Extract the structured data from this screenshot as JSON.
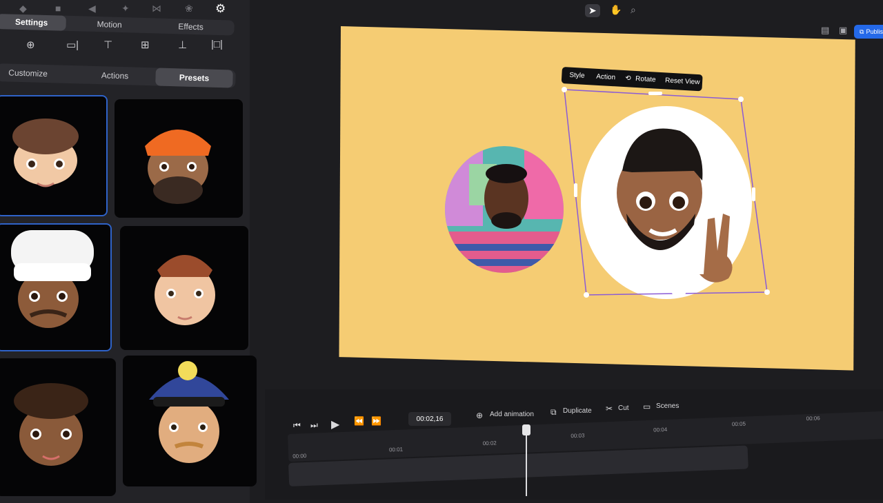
{
  "left_panel": {
    "top_icons": [
      "shape-icon",
      "square-icon",
      "audio-icon",
      "magic-icon",
      "bow-icon",
      "palette-icon",
      "gear-icon"
    ],
    "tabs": [
      {
        "label": "Settings",
        "selected": true
      },
      {
        "label": "Motion",
        "selected": false
      },
      {
        "label": "Effects",
        "selected": false
      }
    ],
    "align_icons": [
      "align-center-horizontal-icon",
      "align-right-icon",
      "align-top-icon",
      "align-middle-icon",
      "align-bottom-icon",
      "distribute-icon"
    ],
    "subtabs": [
      {
        "label": "Customize",
        "selected": false
      },
      {
        "label": "Actions",
        "selected": false
      },
      {
        "label": "Presets",
        "selected": true
      }
    ]
  },
  "canvas_tools": [
    "pointer-icon",
    "hand-icon",
    "zoom-icon"
  ],
  "publish": {
    "label": "Publish"
  },
  "context_toolbar": {
    "style": "Style",
    "action": "Action",
    "rotate": "Rotate",
    "reset_view": "Reset View"
  },
  "timeline": {
    "current_time": "00:02,16",
    "add_animation": "Add animation",
    "duplicate": "Duplicate",
    "cut": "Cut",
    "scenes": "Scenes",
    "ticks": [
      "00:00",
      "00:01",
      "00:02",
      "00:03",
      "00:04",
      "00:05",
      "00:06"
    ],
    "playhead_fraction": 0.41
  },
  "colors": {
    "stage_background": "#f5cc73",
    "publish_button": "#2469e9",
    "selection_frame": "#8a5bd6",
    "card_selected_border": "#2f63c9"
  }
}
